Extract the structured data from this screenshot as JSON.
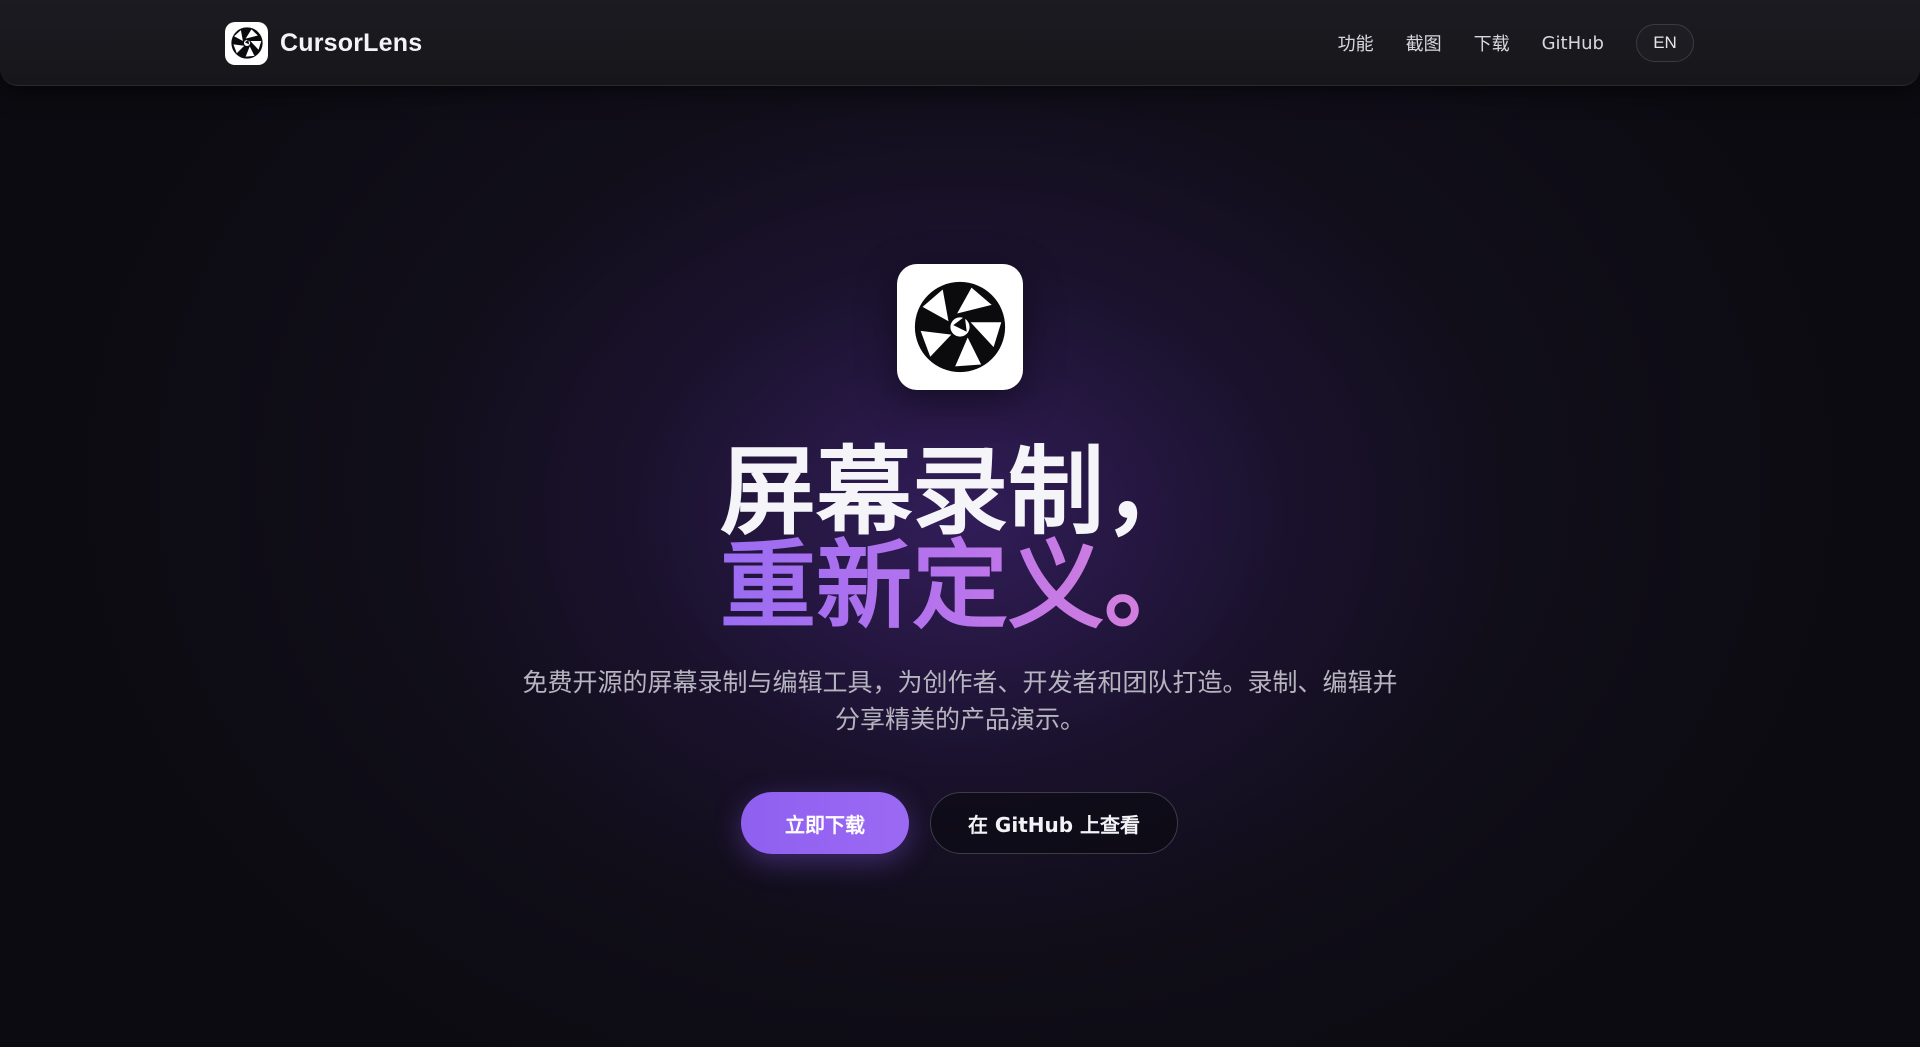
{
  "header": {
    "brand_name": "CursorLens",
    "logo_icon": "aperture-icon",
    "nav": [
      {
        "label": "功能"
      },
      {
        "label": "截图"
      },
      {
        "label": "下载"
      },
      {
        "label": "GitHub"
      }
    ],
    "lang_button": "EN"
  },
  "hero": {
    "app_icon": "aperture-icon",
    "headline_line1": "屏幕录制，",
    "headline_line2": "重新定义。",
    "subtitle": "免费开源的屏幕录制与编辑工具，为创作者、开发者和团队打造。录制、编辑并分享精美的产品演示。",
    "primary_button": "立即下载",
    "secondary_button": "在 GitHub 上查看"
  },
  "colors": {
    "background": "#0c0b11",
    "accent": "#9b6af3",
    "gradient_start": "#9a6cf2",
    "gradient_end": "#dc82d8",
    "text": "#f5f4f8",
    "muted_text": "#b6b4bf"
  }
}
